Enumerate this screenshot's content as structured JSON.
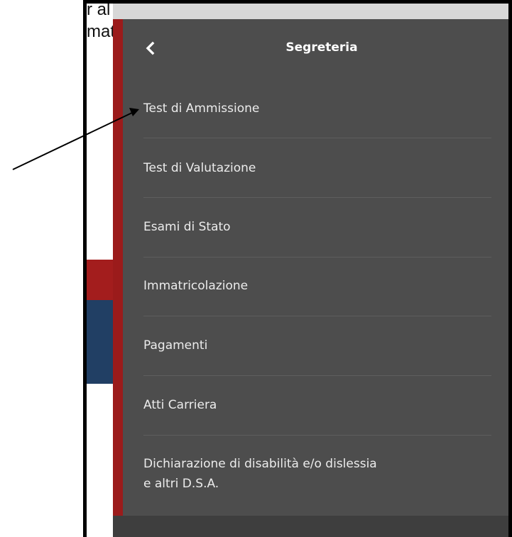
{
  "background_page": {
    "line1": "r al",
    "line2": "mat"
  },
  "menu": {
    "title": "Segreteria",
    "back_icon": "chevron-left-icon",
    "items": [
      {
        "label": "Test di Ammissione"
      },
      {
        "label": "Test di Valutazione"
      },
      {
        "label": "Esami di Stato"
      },
      {
        "label": "Immatricolazione"
      },
      {
        "label": "Pagamenti"
      },
      {
        "label": "Atti Carriera"
      },
      {
        "label_line1": "Dichiarazione di disabilità e/o dislessia",
        "label_line2": "e altri D.S.A."
      }
    ]
  },
  "colors": {
    "panel_bg": "#4d4d4d",
    "accent_red": "#9b1b1b",
    "band_blue": "#213f64",
    "text": "#ececec"
  },
  "annotation": {
    "type": "arrow",
    "points_to": "Test di Ammissione"
  }
}
